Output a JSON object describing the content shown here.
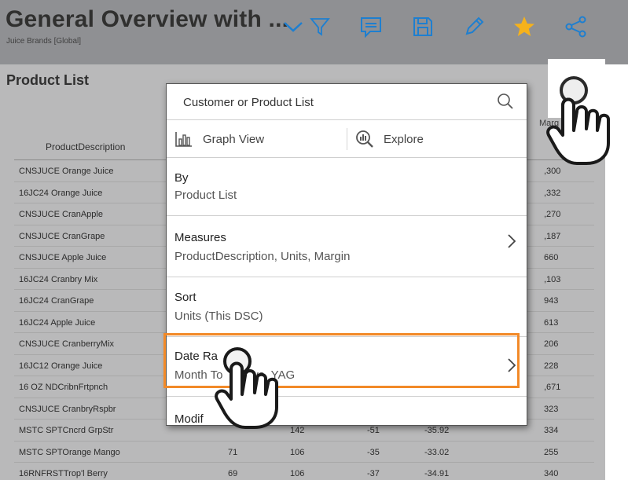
{
  "header": {
    "title": "General Overview with ...",
    "subtitle": "Juice Brands [Global]",
    "icons": [
      "chevron-down-icon",
      "filter-icon",
      "comment-icon",
      "save-icon",
      "edit-icon",
      "star-icon",
      "share-icon"
    ],
    "colors": {
      "accent": "#1e7fd0",
      "star": "#f6b21b",
      "highlight": "#f28a28"
    }
  },
  "page": {
    "section_title": "Product List",
    "margin_header": "Marg",
    "table": {
      "desc_header": "ProductDescription",
      "rows": [
        {
          "desc": "CNSJUCE Orange Juice",
          "units": "",
          "prev": "",
          "chg": "",
          "pct": "",
          "margin": ",300"
        },
        {
          "desc": "16JC24 Orange Juice",
          "units": "",
          "prev": "",
          "chg": "",
          "pct": "",
          "margin": ",332"
        },
        {
          "desc": "CNSJUCE CranApple",
          "units": "",
          "prev": "",
          "chg": "",
          "pct": "",
          "margin": ",270"
        },
        {
          "desc": "CNSJUCE CranGrape",
          "units": "",
          "prev": "",
          "chg": "",
          "pct": "",
          "margin": ",187"
        },
        {
          "desc": "CNSJUCE Apple Juice",
          "units": "",
          "prev": "",
          "chg": "",
          "pct": "",
          "margin": "660"
        },
        {
          "desc": "16JC24 Cranbry Mix",
          "units": "",
          "prev": "",
          "chg": "",
          "pct": "",
          "margin": ",103"
        },
        {
          "desc": "16JC24 CranGrape",
          "units": "",
          "prev": "",
          "chg": "",
          "pct": "",
          "margin": "943"
        },
        {
          "desc": "16JC24 Apple Juice",
          "units": "",
          "prev": "",
          "chg": "",
          "pct": "",
          "margin": "613"
        },
        {
          "desc": "CNSJUCE CranberryMix",
          "units": "",
          "prev": "",
          "chg": "",
          "pct": "",
          "margin": "206"
        },
        {
          "desc": "16JC12 Orange Juice",
          "units": "",
          "prev": "",
          "chg": "",
          "pct": "",
          "margin": "228"
        },
        {
          "desc": "16 OZ NDCribnFrtpnch",
          "units": "",
          "prev": "",
          "chg": "",
          "pct": "",
          "margin": ",671"
        },
        {
          "desc": "CNSJUCE CranbryRspbr",
          "units": "",
          "prev": "",
          "chg": "",
          "pct": "",
          "margin": "323"
        },
        {
          "desc": "MSTC SPTCncrd GrpStr",
          "units": "",
          "prev": "142",
          "chg": "-51",
          "pct": "-35.92",
          "margin": "334"
        },
        {
          "desc": "MSTC SPTOrange Mango",
          "units": "71",
          "prev": "106",
          "chg": "-35",
          "pct": "-33.02",
          "margin": "255"
        },
        {
          "desc": "16RNFRSTTrop'l Berry",
          "units": "69",
          "prev": "106",
          "chg": "-37",
          "pct": "-34.91",
          "margin": "340"
        }
      ]
    }
  },
  "popup": {
    "title": "Customer or Product List",
    "tabs": {
      "graph": "Graph View",
      "explore": "Explore"
    },
    "items": {
      "by": {
        "label": "By",
        "value": "Product List"
      },
      "measures": {
        "label": "Measures",
        "value": "ProductDescription, Units, Margin"
      },
      "sort": {
        "label": "Sort",
        "value": "Units (This DSC)"
      },
      "date_range": {
        "label": "Date Ra",
        "value": "Month To",
        "value2": "e vs. YAG"
      },
      "modify": {
        "label": "Modif"
      }
    }
  }
}
